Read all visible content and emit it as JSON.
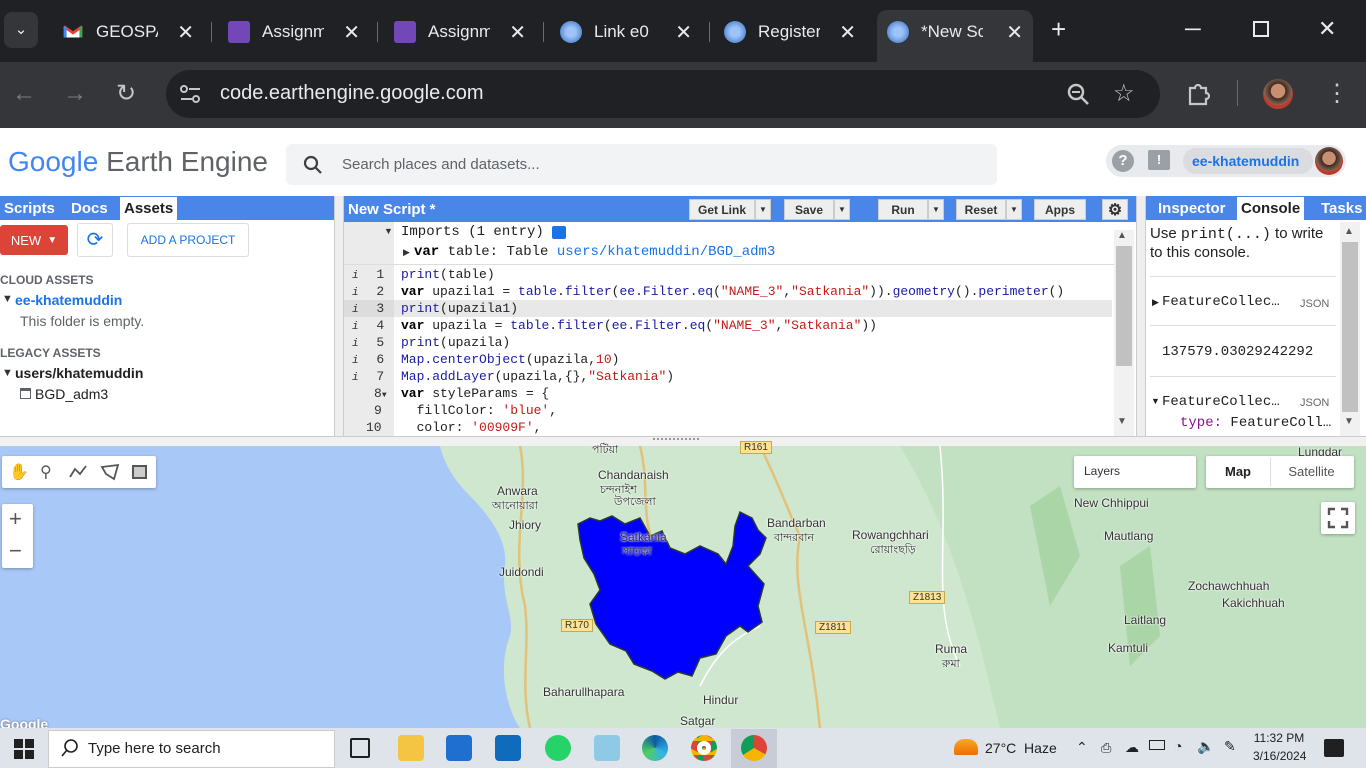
{
  "browser": {
    "tabs": [
      {
        "title": "GEOSPA",
        "icon": "gmail-icon"
      },
      {
        "title": "Assignm",
        "icon": "forms-icon"
      },
      {
        "title": "Assignm",
        "icon": "forms-icon"
      },
      {
        "title": "Link e0",
        "icon": "gear-globe-icon"
      },
      {
        "title": "Register",
        "icon": "gear-globe-icon"
      },
      {
        "title": "*New Sc",
        "icon": "gear-globe-icon"
      }
    ],
    "url": "code.earthengine.google.com"
  },
  "gee": {
    "brand_google": "Google",
    "brand_ee": "Earth Engine",
    "search_placeholder": "Search places and datasets...",
    "user": "ee-khatemuddin"
  },
  "left_panel": {
    "tabs": [
      "Scripts",
      "Docs",
      "Assets"
    ],
    "new_label": "NEW",
    "add_project": "ADD A PROJECT",
    "cloud_assets": "CLOUD ASSETS",
    "project": "ee-khatemuddin",
    "empty_msg": "This folder is empty.",
    "legacy_assets": "LEGACY ASSETS",
    "legacy_user": "users/khatemuddin",
    "table_asset": "BGD_adm3"
  },
  "editor": {
    "title": "New Script *",
    "buttons": {
      "get_link": "Get Link",
      "save": "Save",
      "run": "Run",
      "reset": "Reset",
      "apps": "Apps"
    },
    "imports_header": "Imports (1 entry)",
    "import_kw": "var",
    "import_name": "table",
    "import_type": "Table",
    "import_path": "users/khatemuddin/BGD_adm3",
    "line_numbers": [
      "1",
      "2",
      "3",
      "4",
      "5",
      "6",
      "7",
      "8",
      "9",
      "10"
    ]
  },
  "right_panel": {
    "tabs": [
      "Inspector",
      "Console",
      "Tasks"
    ],
    "hint_pre": "Use ",
    "hint_code": "print(...)",
    "hint_post": " to write",
    "hint_line2": "to this console.",
    "entries": [
      {
        "text": "FeatureCollec…",
        "tag": "JSON"
      },
      {
        "text": "137579.03029242292"
      },
      {
        "text": "FeatureCollec…",
        "tag": "JSON"
      }
    ],
    "type_key": "type:",
    "type_val": "FeatureColl…"
  },
  "map": {
    "layers_label": "Layers",
    "map_btn": "Map",
    "satellite_btn": "Satellite",
    "zoom_in": "+",
    "zoom_out": "−",
    "labels": [
      "Chandanaish",
      "চন্দনাইশ",
      "উপজেলা",
      "Anwara",
      "আনোয়ারা",
      "Jhiory",
      "Satkania",
      "সাতকা",
      "Juidondi",
      "Bandarban",
      "বান্দরবান",
      "Rowangchhari",
      "রোয়াংছড়ি",
      "New Chhippui",
      "Mautlang",
      "Zochawchhuah",
      "Kakichhuah",
      "Laitlang",
      "Kamtuli",
      "Ruma",
      "রুমা",
      "Baharullhapara",
      "Hindur",
      "Satgar",
      "Lungdar",
      "পটিয়া"
    ],
    "roads": [
      "R161",
      "R170",
      "Z1811",
      "Z1813"
    ]
  },
  "taskbar": {
    "search_placeholder": "Type here to search",
    "weather": "27°C  Haze",
    "time": "11:32 PM",
    "date": "3/16/2024"
  }
}
